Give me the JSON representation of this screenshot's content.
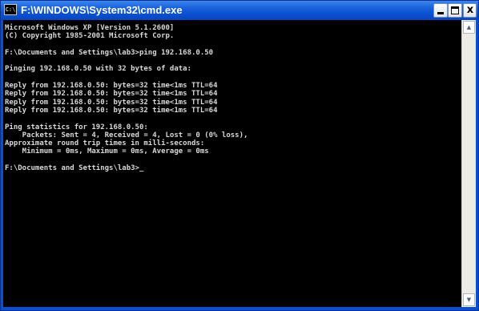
{
  "window": {
    "title": "F:\\WINDOWS\\System32\\cmd.exe",
    "icon_label": "C:\\",
    "colors": {
      "titlebar": "#0a4fd0",
      "console_bg": "#000000",
      "console_text": "#d8d8d8"
    }
  },
  "controls": {
    "minimize_icon": "minimize-icon",
    "maximize_icon": "maximize-icon",
    "close_icon": "close-icon",
    "close_glyph": "x"
  },
  "console": {
    "lines": [
      "Microsoft Windows XP [Version 5.1.2600]",
      "(C) Copyright 1985-2001 Microsoft Corp.",
      "",
      "F:\\Documents and Settings\\lab3>ping 192.168.0.50",
      "",
      "Pinging 192.168.0.50 with 32 bytes of data:",
      "",
      "Reply from 192.168.0.50: bytes=32 time<1ms TTL=64",
      "Reply from 192.168.0.50: bytes=32 time<1ms TTL=64",
      "Reply from 192.168.0.50: bytes=32 time<1ms TTL=64",
      "Reply from 192.168.0.50: bytes=32 time<1ms TTL=64",
      "",
      "Ping statistics for 192.168.0.50:",
      "    Packets: Sent = 4, Received = 4, Lost = 0 (0% loss),",
      "Approximate round trip times in milli-seconds:",
      "    Minimum = 0ms, Maximum = 0ms, Average = 0ms",
      "",
      "F:\\Documents and Settings\\lab3>_"
    ]
  },
  "scrollbar": {
    "up_arrow_icon": "scroll-up-arrow-icon",
    "down_arrow_icon": "scroll-down-arrow-icon",
    "up_glyph": "▲",
    "down_glyph": "▼"
  }
}
